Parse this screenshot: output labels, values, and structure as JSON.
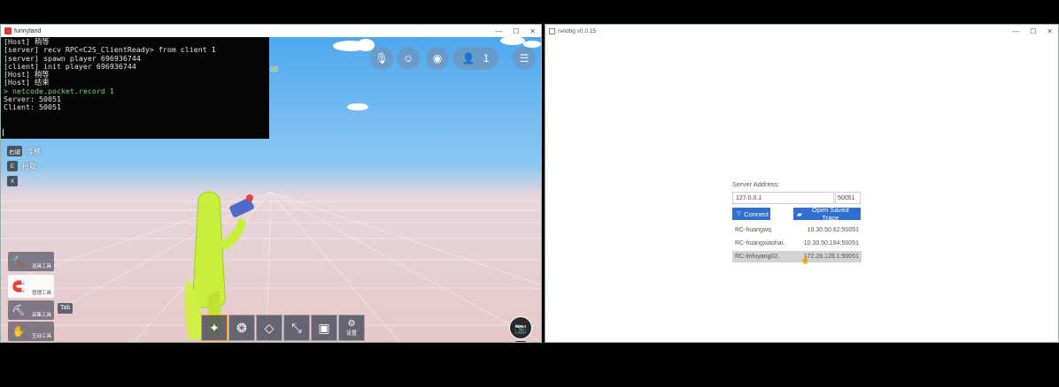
{
  "game_window": {
    "title": "funnyland",
    "console": {
      "lines": [
        {
          "text": "[Host] 稍等",
          "type": "log"
        },
        {
          "text": "[server] recv RPC<C2S_ClientReady> from client 1",
          "type": "log"
        },
        {
          "text": "[server] spawn player 696936744",
          "type": "log"
        },
        {
          "text": "[client] init player 696936744",
          "type": "log"
        },
        {
          "text": "[Host] 稍等",
          "type": "log"
        },
        {
          "text": "[Host] 结束",
          "type": "log"
        },
        {
          "text": "> netcode.pocket.record 1",
          "type": "cmd"
        },
        {
          "text": "Server: 50051",
          "type": "log"
        },
        {
          "text": "Client: 50051",
          "type": "log"
        }
      ]
    },
    "hud_number": "00",
    "player_count": "1",
    "key_hints": [
      {
        "key": "右键",
        "label": "准移"
      },
      {
        "key": "E",
        "label": "拾取"
      },
      {
        "key": "X",
        "label": ""
      }
    ],
    "tools": [
      {
        "label": "道具工具",
        "icon": "hammer-icon"
      },
      {
        "label": "管理工具",
        "icon": "magnet-icon"
      },
      {
        "label": "采集工具",
        "icon": "pickaxe-icon"
      },
      {
        "label": "互动工具",
        "icon": "hand-icon"
      }
    ],
    "tab_key": "Tab",
    "hotbar": {
      "slots": [
        "1",
        "2",
        "3",
        "4",
        "5",
        "6"
      ],
      "settings_label": "设置",
      "active": 0
    }
  },
  "netdbg_window": {
    "title": "netdbg v0.0.15",
    "server_address_label": "Server Address:",
    "address_value": "127.0.0.1",
    "port_value": "50051",
    "connect_label": "Connect",
    "open_trace_label": "Open Saved Trace",
    "servers": [
      {
        "name": "RC-huangwq.",
        "address": "10.30.50.62:50051",
        "selected": false
      },
      {
        "name": "RC-huangxiaohai.",
        "address": "10.30.50.194:50051",
        "selected": false
      },
      {
        "name": "RC-linfuyang02.",
        "address": "172.28.128.1:50051",
        "selected": true
      }
    ]
  }
}
